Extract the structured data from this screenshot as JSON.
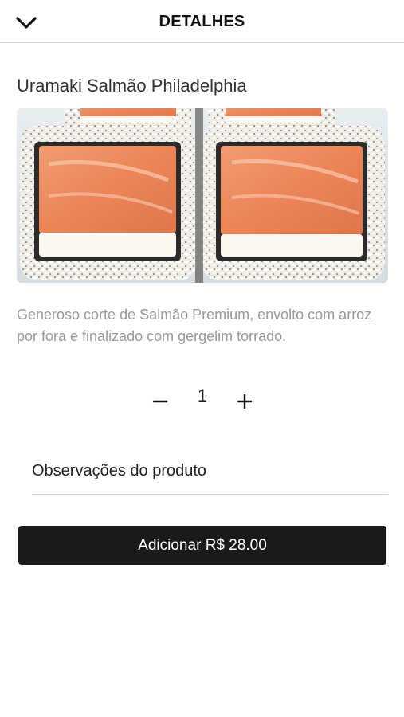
{
  "header": {
    "title": "DETALHES",
    "back_icon": "chevron-down-icon"
  },
  "product": {
    "name": "Uramaki Salmão Philadelphia",
    "image_description_icon": "sushi-image",
    "description": "Generoso corte de Salmão Premium, envolto com arroz por fora e finalizado com gergelim torrado."
  },
  "quantity": {
    "minus_label": "−",
    "value": "1",
    "plus_label": "+"
  },
  "notes": {
    "label": "Observações do produto"
  },
  "add_button": {
    "label": "Adicionar",
    "price": "R$ 28.00"
  },
  "colors": {
    "button_bg": "#1a1a1a",
    "salmon": "#ef8a5e",
    "rice": "#f2f0ea",
    "seaweed": "#2b2b2b"
  }
}
